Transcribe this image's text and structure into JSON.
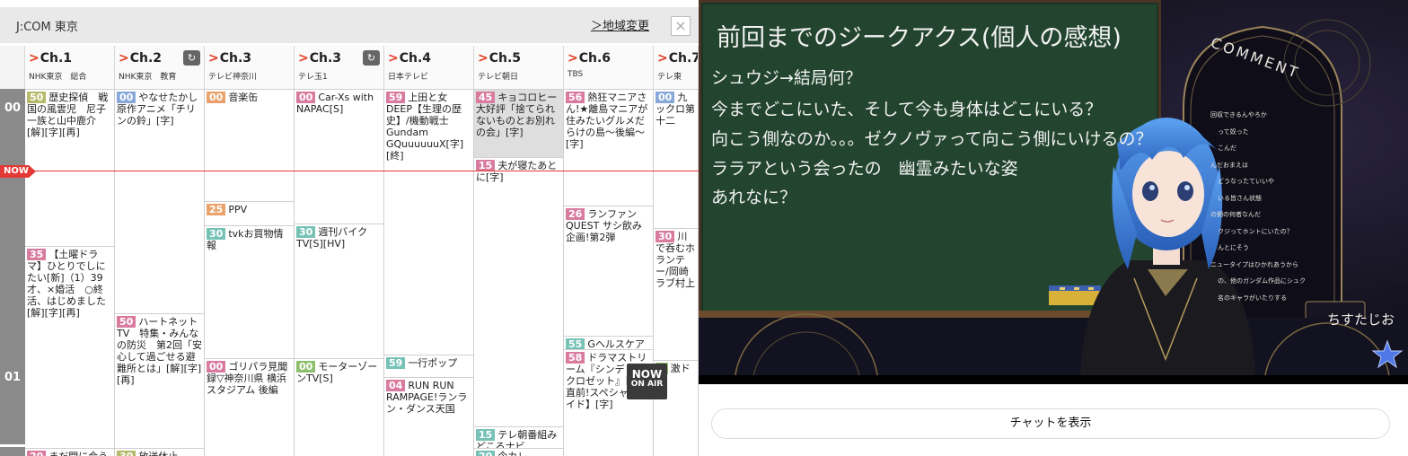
{
  "guide": {
    "region": "J:COM 東京",
    "region_change": "＞地域変更",
    "close_icon": "×",
    "now_label": "NOW",
    "onair_line1": "NOW",
    "onair_line2": "ON AIR",
    "hours": [
      "00",
      "01"
    ],
    "channels": [
      {
        "num": "Ch.1",
        "name": "NHK東京　総合",
        "icon": ""
      },
      {
        "num": "Ch.2",
        "name": "NHK東京　教育",
        "icon": "↻"
      },
      {
        "num": "Ch.3",
        "name": "テレビ神奈川",
        "icon": ""
      },
      {
        "num": "Ch.3",
        "name": "テレ玉1",
        "icon": "↻"
      },
      {
        "num": "Ch.4",
        "name": "日本テレビ",
        "icon": ""
      },
      {
        "num": "Ch.5",
        "name": "テレビ朝日",
        "icon": ""
      },
      {
        "num": "Ch.6",
        "name": "TBS",
        "icon": ""
      },
      {
        "num": "Ch.7",
        "name": "テレ東",
        "icon": ""
      }
    ],
    "programs": [
      [
        {
          "min": "50",
          "title": "歴史探偵　戦国の風雲児　尼子一族と山中鹿介[解][字][再]"
        },
        {
          "min": "35",
          "title": "【土曜ドラマ】ひとりでしにたい[新]（1）39才、×婚活　○終活、はじめました[解][字][再]"
        },
        {
          "min": "20",
          "title": "まだ間に合う"
        }
      ],
      [
        {
          "min": "00",
          "title": "やなせたかし原作アニメ「チリンの鈴」[字]"
        },
        {
          "min": "50",
          "title": "ハートネットTV　特集・みんなの防災　第2回「安心して過ごせる避難所とは」[解][字][再]"
        },
        {
          "min": "30",
          "title": "放送休止"
        }
      ],
      [
        {
          "min": "00",
          "title": "音楽缶"
        },
        {
          "min": "",
          "title": ""
        },
        {
          "min": "25",
          "title": "PPV"
        },
        {
          "min": "30",
          "title": "tvkお買物情報"
        },
        {
          "min": "00",
          "title": "ゴリパラ見聞録▽神奈川県 横浜スタジアム 後編"
        }
      ],
      [
        {
          "min": "00",
          "title": "Car-Xs with NAPAC[S]"
        },
        {
          "min": "30",
          "title": "週刊バイクTV[S][HV]"
        },
        {
          "min": "00",
          "title": "モーターゾーンTV[S]"
        }
      ],
      [
        {
          "min": "59",
          "title": "上田と女DEEP【生理の歴史】/機動戦士Gundam GQuuuuuuX[字][終]"
        },
        {
          "min": "59",
          "title": "一行ポップ"
        },
        {
          "min": "04",
          "title": "RUN RUN RAMPAGE!ランラン・ダンス天国"
        }
      ],
      [
        {
          "min": "45",
          "title": "キョコロヒー大好評「捨てられないものとお別れの会」[字]"
        },
        {
          "min": "15",
          "title": "夫が寝たあとに[字]"
        },
        {
          "min": "15",
          "title": "テレ朝番組みどころナビ"
        },
        {
          "min": "20",
          "title": "今カレ"
        }
      ],
      [
        {
          "min": "56",
          "title": "熱狂マニアさん!★離島マニアが住みたいグルメだらけの島～後編～[字]"
        },
        {
          "min": "26",
          "title": "ランファンQUEST サシ飲み企画!第2弾"
        },
        {
          "min": "55",
          "title": "Gヘルスケア"
        },
        {
          "min": "58",
          "title": "ドラマストリーム『シンデレラクロゼット』【放送直前!スペシャルガイド】[字]"
        }
      ],
      [
        {
          "min": "00",
          "title": "九ックロ第十二"
        },
        {
          "min": "30",
          "title": "川で呑むホランテー/岡崎ラブ村上"
        },
        {
          "min": "0",
          "title": "激ドル"
        }
      ]
    ]
  },
  "stream": {
    "board_title": "前回までのジークアクス(個人の感想)",
    "board_lines": [
      "シュウジ→結局何？",
      "今までどこにいた、そして今も身体はどこにいる？",
      "向こう側なのか。。。ゼクノヴァって向こう側にいけるの？",
      "ララアという会ったの　幽霊みたいな姿",
      "あれなに？"
    ],
    "comment_panel_title": "COMMENT",
    "comment_lines": [
      "回収できるんやろか",
      "って奴った",
      "こんだ",
      "んだおまえは",
      "どうなったていいや",
      "いる皆さん状態",
      "の側の何者なんだ",
      "クジってホントにいたの？",
      "んとにそう",
      "ニュータイプはひかれあうから",
      "の、他のガンダム作品にシュク",
      "名のキャラがいたりする"
    ],
    "comment_panel_name": "ちすたじお"
  },
  "chat": {
    "show_chat_label": "チャットを表示"
  },
  "colors": {
    "accent_red": "#e53935",
    "chalkboard": "#23452f",
    "hair_blue": "#3f7fd6"
  }
}
